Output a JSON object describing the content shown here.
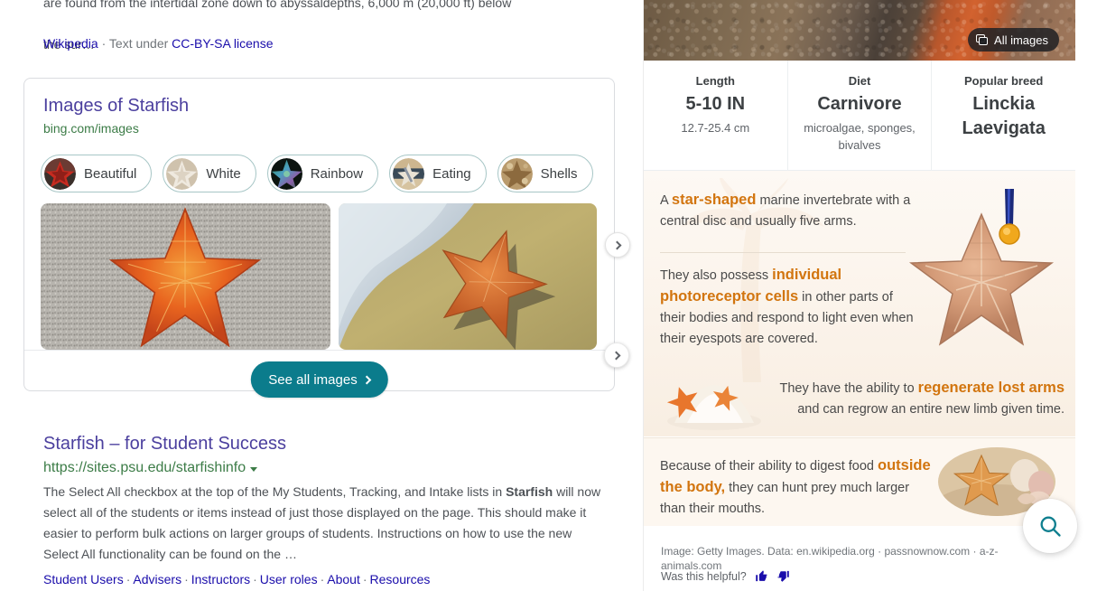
{
  "left": {
    "snippet_tail_top": "are found from the intertidal zone down to abyssaldepths, 6,000 m (20,000 ft) below",
    "snippet_tail_bottom": "the sur…",
    "attribution": {
      "source": "Wikipedia",
      "separator": "·",
      "license_prefix": "Text under",
      "license": "CC-BY-SA license"
    },
    "images_card": {
      "title": "Images of Starfish",
      "url": "bing.com/images",
      "chips": [
        {
          "label": "Beautiful",
          "icon": "starfish-red-thumb"
        },
        {
          "label": "White",
          "icon": "starfish-white-thumb"
        },
        {
          "label": "Rainbow",
          "icon": "starfish-rainbow-thumb"
        },
        {
          "label": "Eating",
          "icon": "starfish-eating-thumb"
        },
        {
          "label": "Shells",
          "icon": "starfish-shells-thumb"
        }
      ],
      "chips_next_icon": "chevron-right-icon",
      "thumbs_next_icon": "chevron-right-icon",
      "thumbnails": [
        {
          "alt": "Orange starfish on grey sand"
        },
        {
          "alt": "Starfish on wet beach sand with sea foam"
        }
      ],
      "see_all_label": "See all images",
      "see_all_icon": "chevron-right-icon"
    },
    "result": {
      "title": "Starfish – for Student Success",
      "url": "https://sites.psu.edu/starfishinfo",
      "url_caret_icon": "caret-down-icon",
      "description_parts": [
        {
          "t": "The Select All checkbox at the top of the My Students, Tracking, and Intake lists in ",
          "b": false
        },
        {
          "t": "Starfish",
          "b": true
        },
        {
          "t": " will now select all of the students or items instead of just those displayed on the page. This should make it easier to perform bulk actions on larger groups of students. Instructions on how to use the new Select All functionality can be found on the …",
          "b": false
        }
      ],
      "sitelinks": [
        "Student Users",
        "Advisers",
        "Instructors",
        "User roles",
        "About",
        "Resources"
      ],
      "sitelink_sep": "·"
    }
  },
  "right": {
    "hero": {
      "all_images_label": "All images",
      "all_images_icon": "image-stack-icon",
      "alt": "Close-up of starfish skin texture"
    },
    "stats": [
      {
        "label": "Length",
        "value": "5-10 IN",
        "sub": "12.7-25.4 cm"
      },
      {
        "label": "Diet",
        "value": "Carnivore",
        "sub": "microalgae, sponges, bivalves"
      },
      {
        "label": "Popular breed",
        "value": "Linckia Laevigata",
        "sub": ""
      }
    ],
    "facts": [
      {
        "parts": [
          {
            "t": "A ",
            "hl": false
          },
          {
            "t": "star-shaped",
            "hl": true
          },
          {
            "t": " marine invertebrate with a central disc and usually five arms.",
            "hl": false
          }
        ]
      },
      {
        "parts": [
          {
            "t": "They also possess ",
            "hl": false
          },
          {
            "t": "individual photoreceptor cells",
            "hl": true
          },
          {
            "t": " in other parts of their bodies and respond to light even when their eyespots are covered.",
            "hl": false
          }
        ]
      },
      {
        "parts": [
          {
            "t": "They have the ability to ",
            "hl": false
          },
          {
            "t": "regenerate lost arms",
            "hl": true
          },
          {
            "t": " and can regrow an entire new limb given time.",
            "hl": false
          }
        ]
      },
      {
        "parts": [
          {
            "t": "Because of their ability to digest food ",
            "hl": false
          },
          {
            "t": "outside the body,",
            "hl": true
          },
          {
            "t": " they can hunt prey much larger than their mouths.",
            "hl": false
          }
        ]
      }
    ],
    "source_line": "Image: Getty Images. Data: en.wikipedia.org · passnownow.com · a-z-animals.com",
    "feedback": {
      "question": "Was this helpful?",
      "up_icon": "thumb-up-icon",
      "down_icon": "thumb-down-icon"
    },
    "search_fab_icon": "search-icon"
  },
  "colors": {
    "link": "#1a0dab",
    "title_purple": "#4b3f9e",
    "url_green": "#3c7c47",
    "teal_button": "#0b7c8c",
    "highlight_orange": "#d2750f",
    "chip_border": "#a7c6c6",
    "feedback_blue": "#1a0dab"
  }
}
